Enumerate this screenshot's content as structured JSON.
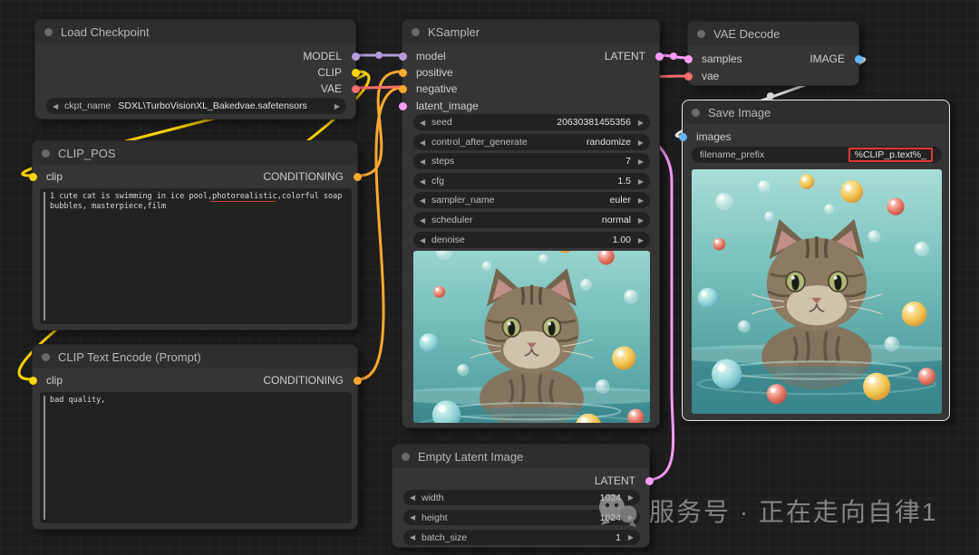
{
  "icons": {
    "left_arrow": "◀",
    "right_arrow": "▶"
  },
  "colors": {
    "canvas_bg": "#1d1d1d",
    "node_bg": "#353535",
    "node_title": "#2e2e2e",
    "model": "#b39ddb",
    "clip": "#ffd500",
    "vae": "#ff6e6e",
    "conditioning": "#ffa931",
    "latent": "#ff9cf9",
    "image": "#64b5f6",
    "image_link": "#e8e8e8",
    "selection_border": "#e9e9e9",
    "highlight_box": "#e53935"
  },
  "nodes": {
    "load_checkpoint": {
      "title": "Load Checkpoint",
      "outputs": [
        "MODEL",
        "CLIP",
        "VAE"
      ],
      "widgets": [
        {
          "name": "ckpt_name",
          "value": "SDXL\\TurboVisionXL_Bakedvae.safetensors"
        }
      ]
    },
    "clip_pos": {
      "title": "CLIP_POS",
      "inputs": [
        "clip"
      ],
      "outputs": [
        "CONDITIONING"
      ],
      "text": "1 cute cat is swimming in ice pool,photorealistic,colorful soap\nbubbles, masterpiece,film"
    },
    "clip_neg": {
      "title": "CLIP Text Encode (Prompt)",
      "inputs": [
        "clip"
      ],
      "outputs": [
        "CONDITIONING"
      ],
      "text": "bad quality,"
    },
    "ksampler": {
      "title": "KSampler",
      "inputs": [
        "model",
        "positive",
        "negative",
        "latent_image"
      ],
      "outputs": [
        "LATENT"
      ],
      "widgets": [
        {
          "name": "seed",
          "value": "20630381455356"
        },
        {
          "name": "control_after_generate",
          "value": "randomize"
        },
        {
          "name": "steps",
          "value": "7"
        },
        {
          "name": "cfg",
          "value": "1.5"
        },
        {
          "name": "sampler_name",
          "value": "euler"
        },
        {
          "name": "scheduler",
          "value": "normal"
        },
        {
          "name": "denoise",
          "value": "1.00"
        }
      ]
    },
    "vae_decode": {
      "title": "VAE Decode",
      "inputs": [
        "samples",
        "vae"
      ],
      "outputs": [
        "IMAGE"
      ]
    },
    "save_image": {
      "title": "Save Image",
      "inputs": [
        "images"
      ],
      "widgets": [
        {
          "name": "filename_prefix",
          "value": "%CLIP_p.text%_"
        }
      ]
    },
    "empty_latent": {
      "title": "Empty Latent Image",
      "outputs": [
        "LATENT"
      ],
      "widgets": [
        {
          "name": "width",
          "value": "1024"
        },
        {
          "name": "height",
          "value": "1024"
        },
        {
          "name": "batch_size",
          "value": "1"
        }
      ]
    }
  },
  "watermark": {
    "text": "服务号 · 正在走向自律1"
  }
}
